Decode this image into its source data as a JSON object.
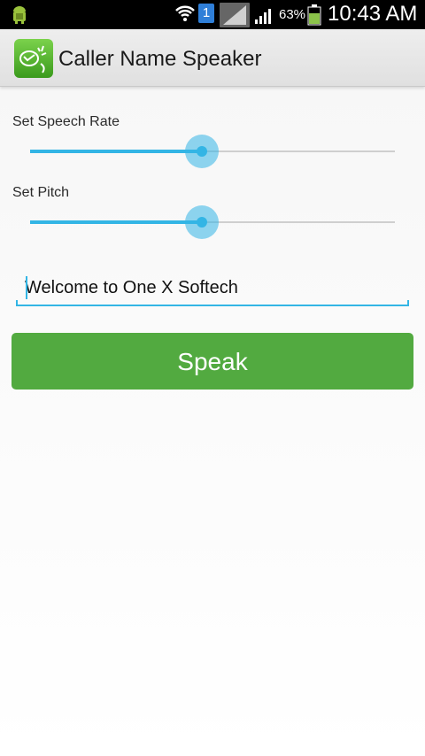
{
  "status_bar": {
    "sim_number": "1",
    "battery_percent": "63%",
    "time": "10:43 AM"
  },
  "app": {
    "title": "Caller Name Speaker",
    "accent_color": "#33b5e5",
    "button_color": "#52aa40"
  },
  "speech_rate": {
    "label": "Set Speech Rate",
    "value_fraction": 0.47
  },
  "pitch": {
    "label": "Set Pitch",
    "value_fraction": 0.47
  },
  "text_input": {
    "value": "Welcome to One X Softech"
  },
  "speak_button": {
    "label": "Speak"
  },
  "icons": [
    "android-debug-icon",
    "wifi-icon",
    "signal-icon",
    "battery-icon",
    "app-logo-icon"
  ]
}
